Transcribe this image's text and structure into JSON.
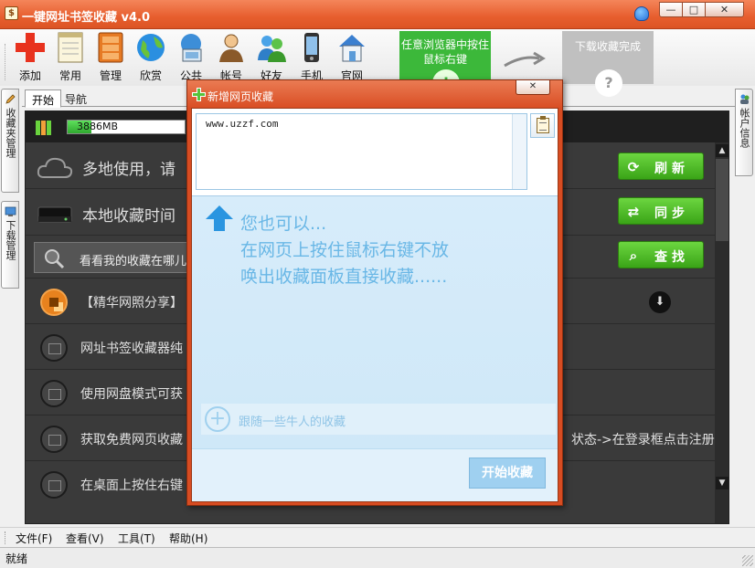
{
  "app": {
    "title": "一键网址书签收藏 v4.0",
    "window_controls": [
      "—",
      "□",
      "✕"
    ]
  },
  "toolbar": {
    "items": [
      {
        "label": "添加",
        "icon": "add-icon"
      },
      {
        "label": "常用",
        "icon": "notepad-icon"
      },
      {
        "label": "管理",
        "icon": "cabinet-icon"
      },
      {
        "label": "欣赏",
        "icon": "globe-icon"
      },
      {
        "label": "公共",
        "icon": "network-icon"
      },
      {
        "label": "帐号",
        "icon": "user-icon"
      },
      {
        "label": "好友",
        "icon": "friends-icon"
      },
      {
        "label": "手机",
        "icon": "phone-icon"
      },
      {
        "label": "官网",
        "icon": "home-icon"
      }
    ],
    "tip_green": "任意浏览器中按住鼠标右键",
    "tip_gray": "下载收藏完成",
    "tip_symbol_green": "!",
    "tip_symbol_gray": "?"
  },
  "side_tabs": {
    "left": [
      "收藏夹管理",
      "下载管理"
    ],
    "right": [
      "帐户信息"
    ]
  },
  "tabs": [
    "开始",
    "导航"
  ],
  "storage": {
    "label": "3886MB",
    "fill_fraction": 0.2
  },
  "main": {
    "row_cloud": "多地使用，请",
    "row_local": "本地收藏时间",
    "search_placeholder": "看看我的收藏在哪儿",
    "list": [
      {
        "text": "【精华网照分享】",
        "icon": "share-icon"
      },
      {
        "text": "网址书签收藏器纯",
        "icon": "photo-icon"
      },
      {
        "text": "使用网盘模式可获",
        "icon": "photo-icon"
      },
      {
        "text": "获取免费网页收藏",
        "icon": "photo-icon",
        "text_right": "状态->在登录框点击注册新"
      },
      {
        "text": "在桌面上按住右键",
        "icon": "photo-icon"
      }
    ],
    "buttons": {
      "refresh": "刷新",
      "sync": "同步",
      "find": "查找"
    }
  },
  "dialog": {
    "title": "新增网页收藏",
    "close": "✕",
    "url_value": "www.uzzf.com",
    "hint_lines": [
      "您也可以...",
      "在网页上按住鼠标右键不放",
      "唤出收藏面板直接收藏......"
    ],
    "follow_text": "跟随一些牛人的收藏",
    "start_button": "开始收藏"
  },
  "menubar": [
    "文件(F)",
    "查看(V)",
    "工具(T)",
    "帮助(H)"
  ],
  "status": "就绪"
}
